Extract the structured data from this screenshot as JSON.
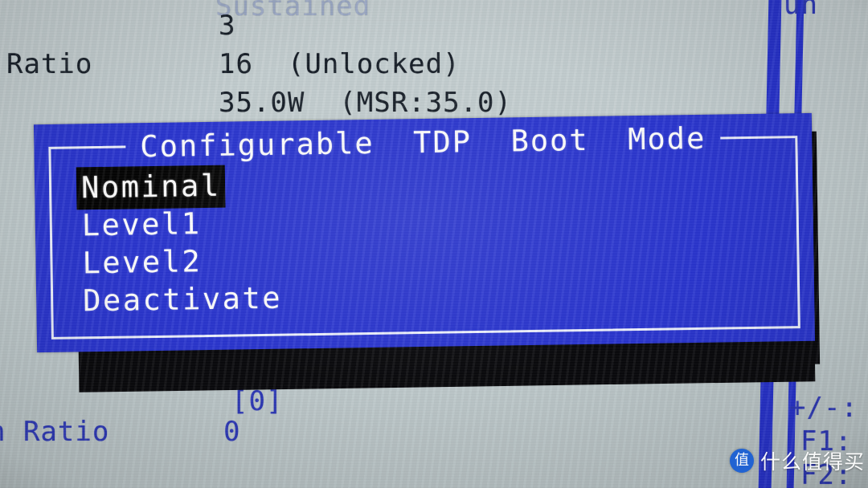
{
  "screen": {
    "background_color": "#c3ced0",
    "text_color": "#121a24",
    "accent_blue": "#2430cf"
  },
  "background_page": {
    "cut_top_line": "Sustained",
    "cut_top_right": "un",
    "rows": [
      {
        "label": "",
        "value": "3"
      },
      {
        "label": "Ratio",
        "value": "16  (Unlocked)"
      },
      {
        "label": "",
        "value": "35.0W  (MSR:35.0)"
      }
    ],
    "lower_rows": [
      {
        "label": "",
        "value": "[0]"
      },
      {
        "label": "n Ratio",
        "value": "0"
      }
    ],
    "help_keys": [
      {
        "key": "+/-:"
      },
      {
        "key": "F1:"
      },
      {
        "key": "F2:"
      }
    ]
  },
  "dialog": {
    "title": "Configurable  TDP  Boot  Mode",
    "background_color": "#2733d0",
    "border_color": "#eef2ff",
    "selected_index": 0,
    "items": [
      {
        "label": "Nominal",
        "selected": true
      },
      {
        "label": "Level1",
        "selected": false
      },
      {
        "label": "Level2",
        "selected": false
      },
      {
        "label": "Deactivate",
        "selected": false
      }
    ]
  },
  "watermark": {
    "logo_glyph": "值",
    "text": "什么值得买"
  }
}
